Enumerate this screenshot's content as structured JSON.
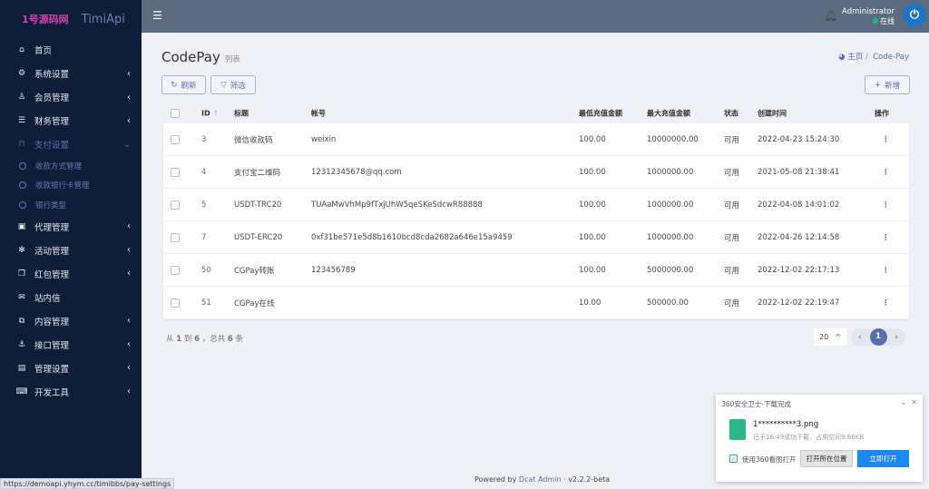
{
  "app": {
    "logo_text": "1号源码网",
    "name": "TimiApi"
  },
  "sidebar": {
    "items": [
      {
        "label": "首页",
        "icon": "home-icon",
        "chev": ""
      },
      {
        "label": "系统设置",
        "icon": "gears-icon",
        "chev": "‹"
      },
      {
        "label": "会员管理",
        "icon": "user-icon",
        "chev": "‹"
      },
      {
        "label": "财务管理",
        "icon": "database-icon",
        "chev": "‹"
      },
      {
        "label": "支付设置",
        "icon": "bookmark-icon",
        "chev": "⌄",
        "active": true,
        "children": [
          {
            "label": "收款方式管理"
          },
          {
            "label": "收款银行卡管理"
          },
          {
            "label": "银行类型"
          }
        ]
      },
      {
        "label": "代理管理",
        "icon": "contact-icon",
        "chev": "‹"
      },
      {
        "label": "活动管理",
        "icon": "pinwheel-icon",
        "chev": "‹"
      },
      {
        "label": "红包管理",
        "icon": "clone-icon",
        "chev": "‹"
      },
      {
        "label": "站内信",
        "icon": "envelope-icon",
        "chev": ""
      },
      {
        "label": "内容管理",
        "icon": "copy-icon",
        "chev": "‹"
      },
      {
        "label": "接口管理",
        "icon": "anchor-icon",
        "chev": "‹"
      },
      {
        "label": "管理设置",
        "icon": "id-card-icon",
        "chev": "‹"
      },
      {
        "label": "开发工具",
        "icon": "keyboard-icon",
        "chev": "‹"
      }
    ]
  },
  "topbar": {
    "user": "Administrator",
    "status": "在线"
  },
  "page": {
    "title": "CodePay",
    "subtitle": "列表",
    "breadcrumb_home": "主页",
    "breadcrumb_current": "Code-Pay"
  },
  "toolbar": {
    "refresh": "刷新",
    "filter": "筛选",
    "new": "新增"
  },
  "table": {
    "headers": [
      "ID",
      "标题",
      "帐号",
      "最低充值金额",
      "最大充值金额",
      "状态",
      "创建时间",
      "操作"
    ],
    "rows": [
      [
        "3",
        "微信收款码",
        "weixin",
        "100.00",
        "10000000.00",
        "可用",
        "2022-04-23 15:24:30"
      ],
      [
        "4",
        "支付宝二维码",
        "12312345678@qq.com",
        "100.00",
        "1000000.00",
        "可用",
        "2021-05-08 21:38:41"
      ],
      [
        "5",
        "USDT-TRC20",
        "TUAaMwVhMp9fTxjUhW5qeSKeSdcwR88888",
        "100.00",
        "1000000.00",
        "可用",
        "2022-04-08 14:01:02"
      ],
      [
        "7",
        "USDT-ERC20",
        "0xf31be571e5d8b1610bcd8cda2682a646e15a9459",
        "100.00",
        "1000000.00",
        "可用",
        "2022-04-26 12:14:58"
      ],
      [
        "50",
        "CGPay转账",
        "123456789",
        "100.00",
        "5000000.00",
        "可用",
        "2022-12-02 22:17:13"
      ],
      [
        "51",
        "CGPay在线",
        "",
        "10.00",
        "500000.00",
        "可用",
        "2022-12-02 22:19:47"
      ]
    ]
  },
  "pagination": {
    "info_prefix": "从",
    "from": "1",
    "to_label": "到",
    "to": "6",
    "total_label": "，总共",
    "total": "6",
    "unit": "条",
    "per_page": "20",
    "current": "1"
  },
  "footer": {
    "powered": "Powered by",
    "brand": "Dcat Admin",
    "version": "·  v2.2.2-beta"
  },
  "status_url": "https://demoapi.yhym.cc/timibbs/pay-settings",
  "toast": {
    "title": "360安全卫士-下载完成",
    "filename": "1**********3.png",
    "info": "已于16:49成功下载，占用空间9.66KB",
    "checkbox": "使用360看图打开",
    "open_folder": "打开所在位置",
    "open_now": "立即打开"
  }
}
